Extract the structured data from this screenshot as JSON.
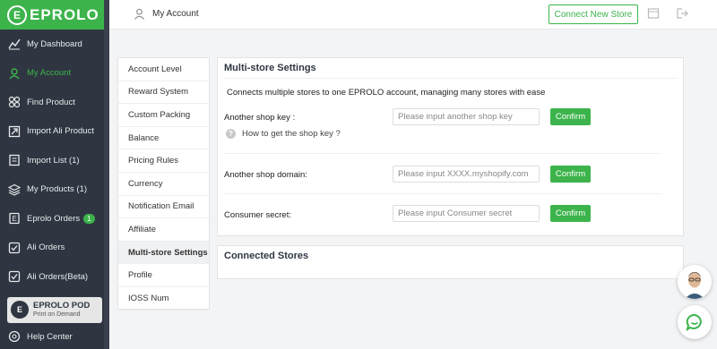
{
  "brand": {
    "logo_text": "EPROLO",
    "logo_mark": "E",
    "accent": "#3cb44b",
    "sidebar_bg": "#2f3641"
  },
  "sidebar": {
    "items": [
      {
        "label": "My Dashboard",
        "icon": "dashboard-chart-icon"
      },
      {
        "label": "My Account",
        "icon": "user-icon",
        "active": true
      },
      {
        "label": "Find Product",
        "icon": "grid-icon"
      },
      {
        "label": "Import Ali Product",
        "icon": "import-icon"
      },
      {
        "label": "Import List (1)",
        "icon": "list-icon"
      },
      {
        "label": "My Products (1)",
        "icon": "layers-icon"
      },
      {
        "label": "Eprolo Orders",
        "icon": "orders-icon",
        "badge": "1"
      },
      {
        "label": "Ali Orders",
        "icon": "check-box-icon"
      },
      {
        "label": "Ali Orders(Beta)",
        "icon": "check-box-icon"
      }
    ],
    "pod": {
      "title": "EPROLO POD",
      "subtitle": "Print on Demand",
      "mark": "E"
    },
    "help": {
      "label": "Help Center",
      "icon": "help-circle-icon"
    }
  },
  "header": {
    "breadcrumb": "My Account",
    "connect_button": "Connect New Store"
  },
  "settings_menu": {
    "items": [
      "Account Level",
      "Reward System",
      "Custom Packing",
      "Balance",
      "Pricing Rules",
      "Currency",
      "Notification Email",
      "Affiliate",
      "Multi-store Settings",
      "Profile",
      "IOSS Num"
    ],
    "active": "Multi-store Settings"
  },
  "multistore": {
    "title": "Multi-store Settings",
    "description": "Connects multiple stores to one EPROLO account, managing many stores with ease",
    "rows": {
      "shop_key": {
        "label": "Another shop key :",
        "placeholder": "Please input another shop key",
        "button": "Confirm"
      },
      "shop_domain": {
        "label": "Another shop domain:",
        "placeholder": "Please input   XXXX.myshopify.com",
        "button": "Confirm"
      },
      "consumer_secret": {
        "label": "Consumer secret:",
        "placeholder": "Please input Consumer secret",
        "button": "Confirm"
      }
    },
    "help_link": "How to get the shop key ?"
  },
  "connected_stores": {
    "title": "Connected Stores"
  }
}
